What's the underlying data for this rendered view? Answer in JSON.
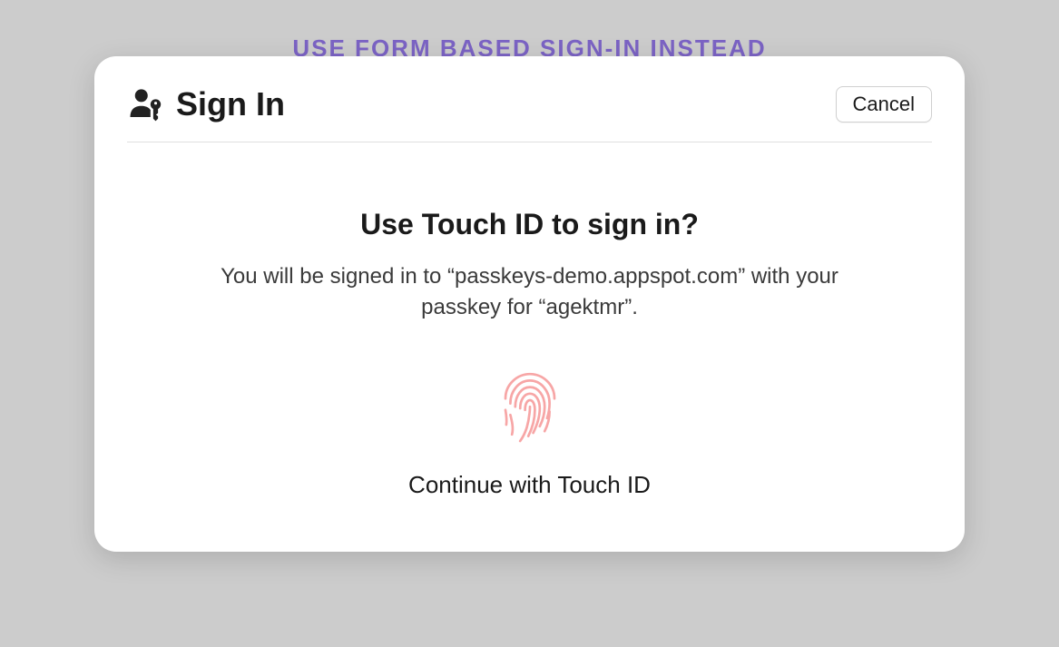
{
  "banner": {
    "link_text": "USE FORM BASED SIGN-IN INSTEAD"
  },
  "modal": {
    "title": "Sign In",
    "cancel_label": "Cancel",
    "body": {
      "heading": "Use Touch ID to sign in?",
      "subtext": "You will be signed in to “passkeys-demo.appspot.com” with your passkey for “agektmr”.",
      "continue_label": "Continue with Touch ID"
    }
  },
  "icons": {
    "passkey": "passkey-icon",
    "fingerprint": "fingerprint-icon"
  },
  "colors": {
    "background": "#cccccc",
    "modal_bg": "#ffffff",
    "link": "#7b63c4",
    "fingerprint": "#f7a6a6",
    "text_primary": "#1a1a1a"
  }
}
